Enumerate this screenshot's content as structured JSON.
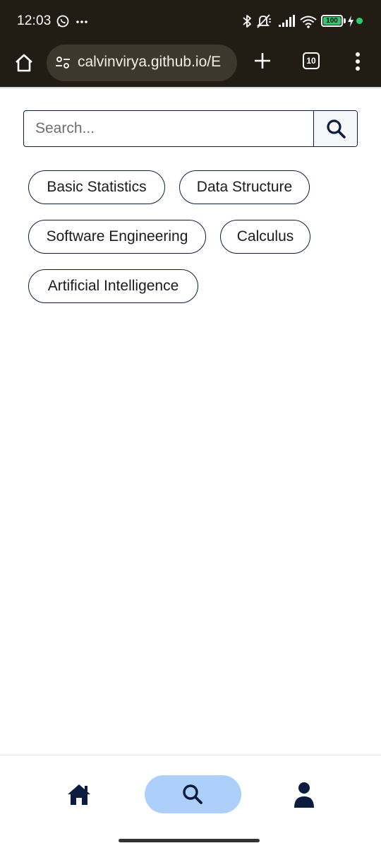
{
  "status_bar": {
    "time": "12:03",
    "battery": "100",
    "icons": [
      "whatsapp-icon",
      "more-notifications-icon",
      "bluetooth-icon",
      "mute-icon",
      "signal-icon",
      "wifi-icon",
      "battery-icon",
      "charging-icon"
    ]
  },
  "browser": {
    "url": "calvinvirya.github.io/E",
    "tab_count": "10"
  },
  "search": {
    "placeholder": "Search..."
  },
  "topics": [
    "Basic Statistics",
    "Data Structure",
    "Software Engineering",
    "Calculus",
    "Artificial Intelligence"
  ],
  "bottom_nav": {
    "items": [
      "home-icon",
      "search-icon",
      "profile-icon"
    ],
    "active": "search",
    "active_color": "#acd0fa",
    "icon_color": "#0b1c3d"
  },
  "colors": {
    "browser_bar": "#211d15",
    "url_pill": "#3d372c",
    "accent_navy": "#0b1c3d"
  }
}
